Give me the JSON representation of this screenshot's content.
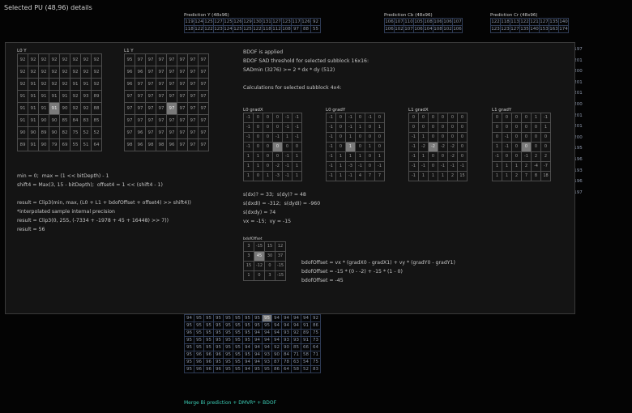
{
  "page_title": "Selected PU (48,96) details",
  "bg_tables": [
    {
      "title": "Prediction Y (48x96)",
      "rows": [
        [
          "119",
          "124",
          "125",
          "127",
          "125",
          "126",
          "129",
          "130",
          "131",
          "127",
          "123",
          "117",
          "126",
          "92"
        ],
        [
          "118",
          "122",
          "122",
          "123",
          "124",
          "125",
          "125",
          "122",
          "118",
          "112",
          "108",
          "97",
          "88",
          "55"
        ]
      ]
    },
    {
      "title": "Prediction Cb (48x96)",
      "rows": [
        [
          "106",
          "107",
          "110",
          "105",
          "108",
          "106",
          "106",
          "107"
        ],
        [
          "106",
          "102",
          "107",
          "106",
          "104",
          "108",
          "102",
          "106"
        ]
      ]
    },
    {
      "title": "Prediction Cr (48x96)",
      "rows": [
        [
          "122",
          "118",
          "113",
          "122",
          "121",
          "127",
          "135",
          "140"
        ],
        [
          "123",
          "123",
          "127",
          "135",
          "140",
          "153",
          "163",
          "174"
        ]
      ]
    }
  ],
  "right_edge_values": [
    "197",
    "201",
    "200",
    "201",
    "201",
    "200",
    "201",
    "201",
    "200",
    "195",
    "196",
    "193",
    "196",
    "197"
  ],
  "l0y": {
    "title": "L0 Y",
    "highlight": [
      4,
      3
    ],
    "rows": [
      [
        "92",
        "92",
        "92",
        "92",
        "92",
        "92",
        "92",
        "92"
      ],
      [
        "92",
        "92",
        "92",
        "92",
        "92",
        "92",
        "92",
        "92"
      ],
      [
        "92",
        "91",
        "92",
        "92",
        "92",
        "91",
        "91",
        "92"
      ],
      [
        "91",
        "91",
        "91",
        "91",
        "91",
        "92",
        "93",
        "89"
      ],
      [
        "91",
        "91",
        "91",
        "91",
        "90",
        "92",
        "92",
        "88"
      ],
      [
        "91",
        "91",
        "90",
        "90",
        "85",
        "84",
        "83",
        "85"
      ],
      [
        "90",
        "90",
        "89",
        "90",
        "82",
        "75",
        "52",
        "52"
      ],
      [
        "89",
        "91",
        "90",
        "79",
        "69",
        "55",
        "51",
        "64"
      ]
    ]
  },
  "l1y": {
    "title": "L1 Y",
    "highlight": [
      4,
      4
    ],
    "rows": [
      [
        "95",
        "97",
        "97",
        "97",
        "97",
        "97",
        "97",
        "97"
      ],
      [
        "96",
        "96",
        "97",
        "97",
        "97",
        "97",
        "97",
        "97"
      ],
      [
        "96",
        "97",
        "97",
        "97",
        "97",
        "97",
        "97",
        "97"
      ],
      [
        "97",
        "97",
        "97",
        "97",
        "97",
        "97",
        "97",
        "97"
      ],
      [
        "97",
        "97",
        "97",
        "97",
        "97",
        "97",
        "97",
        "97"
      ],
      [
        "97",
        "97",
        "97",
        "97",
        "97",
        "97",
        "97",
        "97"
      ],
      [
        "97",
        "96",
        "97",
        "97",
        "97",
        "97",
        "97",
        "97"
      ],
      [
        "98",
        "96",
        "98",
        "98",
        "96",
        "97",
        "97",
        "97"
      ]
    ]
  },
  "bdof_text": [
    "BDOF is applied",
    "BDOF SAD threshold for selected subblock 16x16:",
    "SADmin (3276) >= 2 * dx * dy (512)",
    "",
    "Calculations for selected subblock 4x4:"
  ],
  "grads": [
    {
      "title": "L0 gradX",
      "hl": [
        3,
        3
      ],
      "rows": [
        [
          "-1",
          "0",
          "0",
          "0",
          "-1",
          "-1"
        ],
        [
          "-1",
          "0",
          "0",
          "0",
          "-1",
          "-1"
        ],
        [
          "-1",
          "0",
          "0",
          "-1",
          "1",
          "-1"
        ],
        [
          "-1",
          "0",
          "0",
          "0",
          "0",
          "0"
        ],
        [
          "1",
          "1",
          "0",
          "0",
          "-1",
          "1"
        ],
        [
          "1",
          "1",
          "0",
          "-2",
          "-1",
          "1"
        ],
        [
          "1",
          "0",
          "1",
          "-3",
          "-1",
          "1"
        ]
      ]
    },
    {
      "title": "L0 gradY",
      "hl": [
        3,
        2
      ],
      "rows": [
        [
          "-1",
          "0",
          "-1",
          "0",
          "-1",
          "0"
        ],
        [
          "-1",
          "0",
          "-1",
          "1",
          "0",
          "1"
        ],
        [
          "-1",
          "0",
          "1",
          "0",
          "0",
          "0"
        ],
        [
          "-1",
          "0",
          "1",
          "0",
          "1",
          "0"
        ],
        [
          "-1",
          "1",
          "1",
          "1",
          "0",
          "1"
        ],
        [
          "-1",
          "1",
          "-3",
          "-1",
          "0",
          "-1"
        ],
        [
          "-1",
          "1",
          "-1",
          "4",
          "7",
          "7"
        ]
      ]
    },
    {
      "title": "L1 gradX",
      "hl": [
        3,
        2
      ],
      "rows": [
        [
          "0",
          "0",
          "0",
          "0",
          "0",
          "0"
        ],
        [
          "0",
          "0",
          "0",
          "0",
          "0",
          "0"
        ],
        [
          "-1",
          "1",
          "0",
          "0",
          "0",
          "0"
        ],
        [
          "-1",
          "-2",
          "-2",
          "-2",
          "-2",
          "0"
        ],
        [
          "-1",
          "1",
          "0",
          "0",
          "-2",
          "0"
        ],
        [
          "-1",
          "-1",
          "0",
          "-1",
          "-1",
          "-1"
        ],
        [
          "-1",
          "1",
          "1",
          "1",
          "2",
          "15"
        ]
      ]
    },
    {
      "title": "L1 gradY",
      "hl": [
        3,
        3
      ],
      "rows": [
        [
          "0",
          "0",
          "0",
          "0",
          "1",
          "-1"
        ],
        [
          "0",
          "0",
          "0",
          "0",
          "0",
          "1"
        ],
        [
          "0",
          "-1",
          "0",
          "0",
          "0",
          "0"
        ],
        [
          "1",
          "-1",
          "0",
          "0",
          "0",
          "0"
        ],
        [
          "-1",
          "0",
          "0",
          "-1",
          "2",
          "2"
        ],
        [
          "1",
          "1",
          "1",
          "2",
          "-4",
          "-7"
        ],
        [
          "1",
          "1",
          "2",
          "7",
          "8",
          "18"
        ]
      ]
    }
  ],
  "sums": [
    "s(dx)? = 33;  s(dy)? = 48",
    "s(dxdI) = -312;  s(dydI) = -960",
    "s(dxdy) = 74",
    "vx = -15;  vy = -15"
  ],
  "offset_title": "bdofOffset",
  "offset": {
    "hl": [
      1,
      1
    ],
    "rows": [
      [
        "3",
        "-15",
        "15",
        "12"
      ],
      [
        "3",
        "45",
        "30",
        "37"
      ],
      [
        "15",
        "-12",
        "0",
        "-15"
      ],
      [
        "1",
        "0",
        "3",
        "-15"
      ]
    ]
  },
  "formula_lines": [
    "bdofOffset = vx * (gradX0 - gradX1) + vy * (gradY0 - gradY1)",
    "bdofOffset = -15 * (0 - -2) + -15 * (1 - 0)",
    "bdofOffset = -45"
  ],
  "calc_lines": [
    "min = 0;  max = (1 << bitDepth) - 1",
    "shift4 = Max(3, 15 - bitDepth);  offset4 = 1 << (shift4 - 1)",
    "",
    "result = Clip3(min, max, (L0 + L1 + bdofOffset + offset4) >> shift4))",
    "*interpolated sample internal precision",
    "result = Clip3(0, 255, (-7334 + -1978 + 45 + 16448) >> 7))",
    "result = 56"
  ],
  "bottom_grid": {
    "hl": [
      0,
      8
    ],
    "rows": [
      [
        "94",
        "95",
        "95",
        "95",
        "95",
        "95",
        "95",
        "95",
        "95",
        "94",
        "94",
        "94",
        "94",
        "92"
      ],
      [
        "95",
        "95",
        "95",
        "95",
        "95",
        "95",
        "95",
        "95",
        "95",
        "94",
        "94",
        "94",
        "91",
        "86"
      ],
      [
        "96",
        "95",
        "95",
        "95",
        "95",
        "95",
        "95",
        "94",
        "94",
        "94",
        "93",
        "92",
        "89",
        "75"
      ],
      [
        "95",
        "95",
        "95",
        "95",
        "95",
        "95",
        "95",
        "94",
        "94",
        "94",
        "93",
        "93",
        "91",
        "73"
      ],
      [
        "95",
        "95",
        "95",
        "95",
        "95",
        "95",
        "94",
        "94",
        "94",
        "92",
        "90",
        "85",
        "66",
        "64"
      ],
      [
        "95",
        "96",
        "96",
        "96",
        "95",
        "95",
        "95",
        "94",
        "93",
        "90",
        "84",
        "71",
        "58",
        "71"
      ],
      [
        "95",
        "96",
        "96",
        "95",
        "95",
        "95",
        "94",
        "94",
        "93",
        "87",
        "78",
        "63",
        "54",
        "75"
      ],
      [
        "95",
        "96",
        "96",
        "96",
        "95",
        "95",
        "94",
        "95",
        "95",
        "86",
        "64",
        "58",
        "52",
        "83"
      ]
    ]
  },
  "bottom_caption": "Merge Bi prediction + DMVR* + BDOF"
}
